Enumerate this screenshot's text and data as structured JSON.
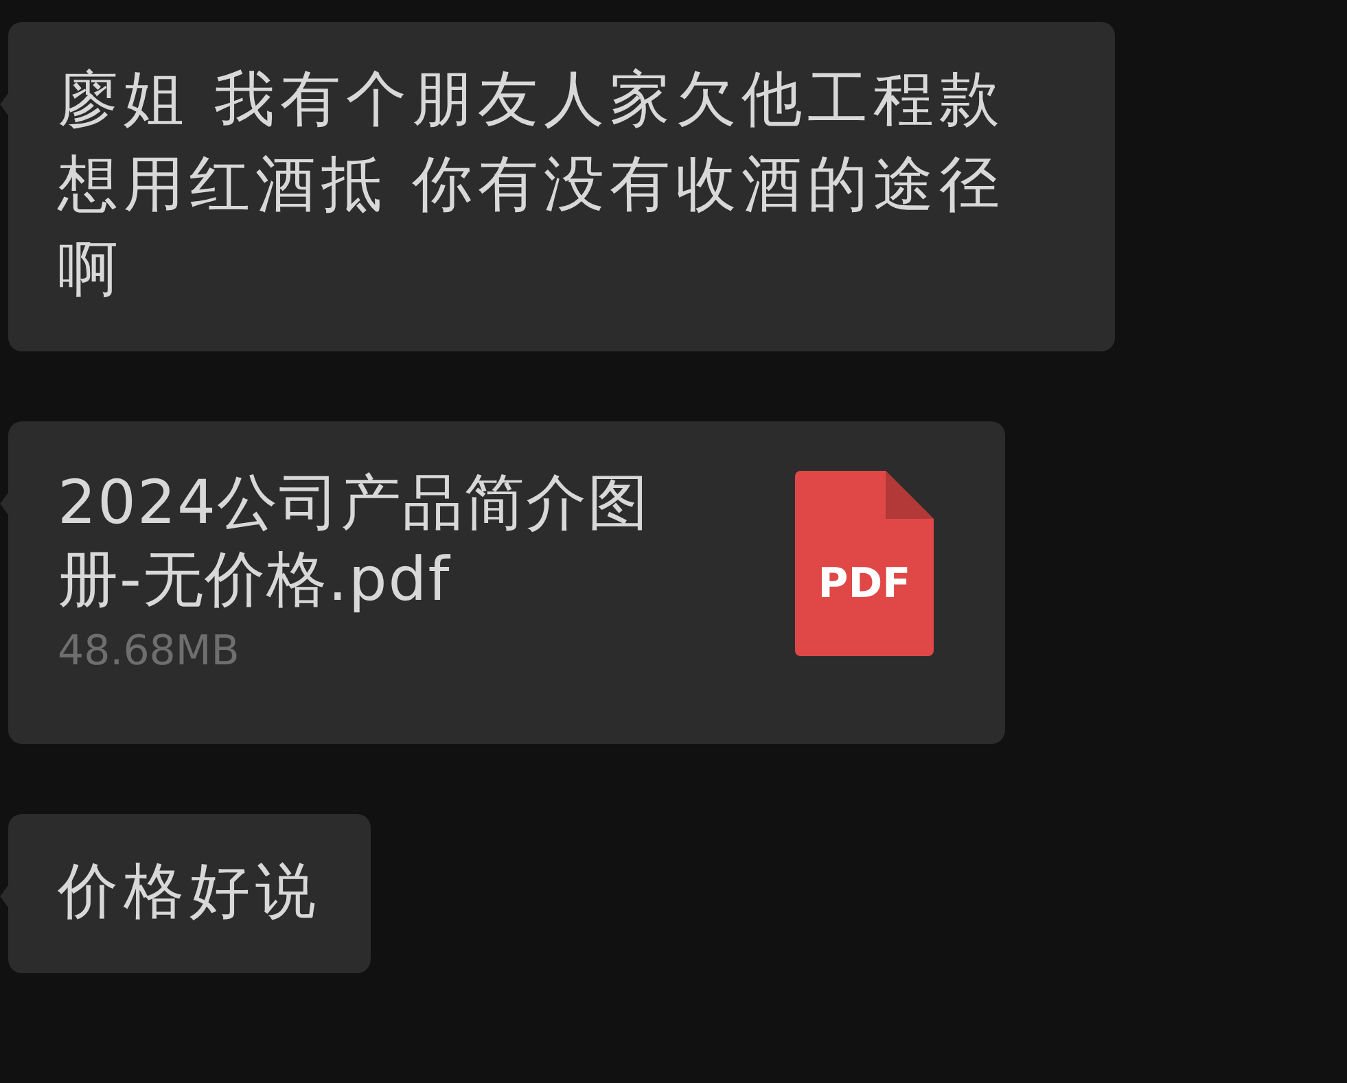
{
  "messages": [
    {
      "kind": "text",
      "text": "廖姐 我有个朋友人家欠他工程款想用红酒抵 你有没有收酒的途径啊"
    },
    {
      "kind": "file",
      "name": "2024公司产品简介图册-无价格.pdf",
      "size": "48.68MB",
      "file_type": "PDF"
    },
    {
      "kind": "text",
      "text": "价格好说"
    }
  ]
}
